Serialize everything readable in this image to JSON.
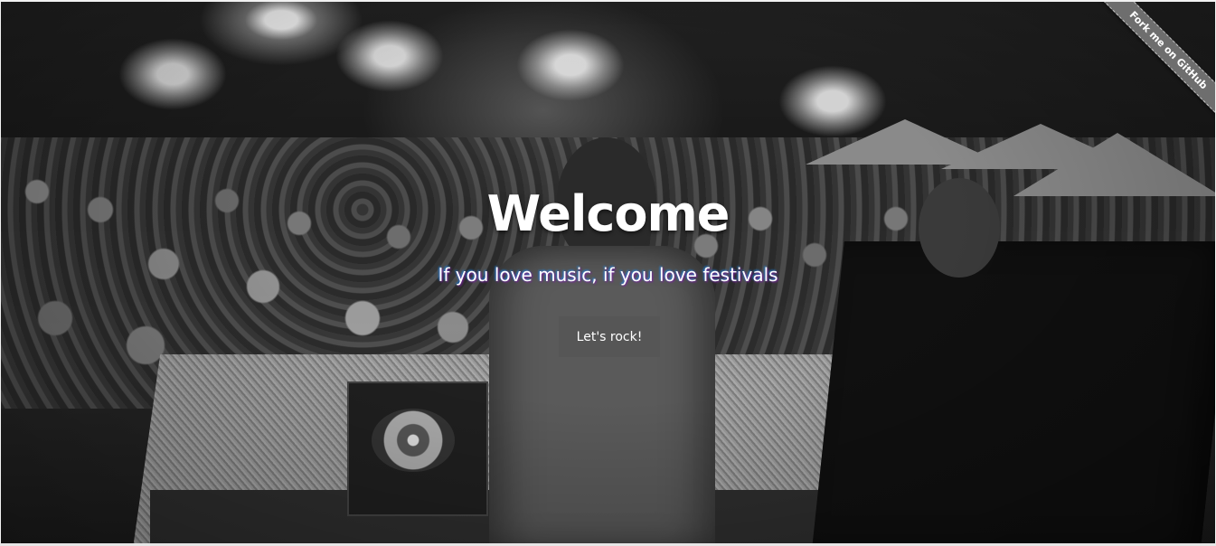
{
  "hero": {
    "title": "Welcome",
    "subtitle": "If you love music, if you love festivals",
    "cta_label": "Let's rock!",
    "background_description_icon": "festival-crowd-photo"
  },
  "ribbon": {
    "label": "Fork me on GitHub",
    "color": "#6e6e6e"
  },
  "colors": {
    "title": "#ffffff",
    "cta_background": "#555555"
  }
}
